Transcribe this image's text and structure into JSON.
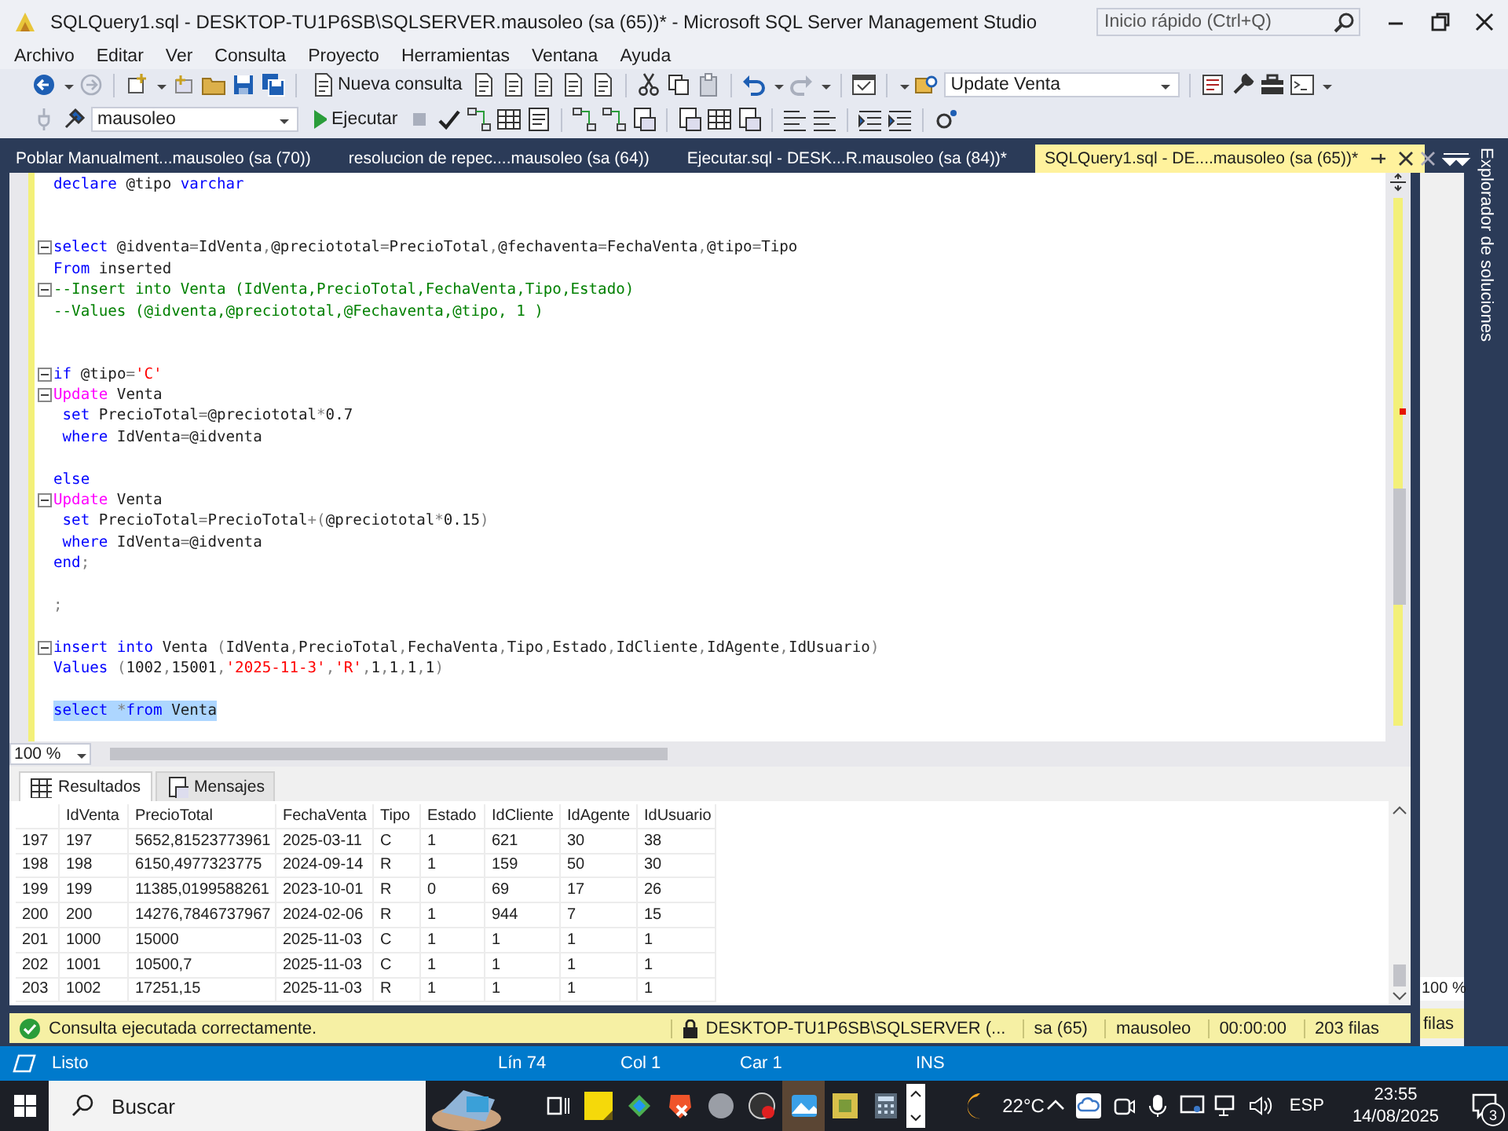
{
  "window": {
    "title": "SQLQuery1.sql - DESKTOP-TU1P6SB\\SQLSERVER.mausoleo (sa (65))* - Microsoft SQL Server Management Studio",
    "quick_launch": {
      "placeholder": "Inicio rápido (Ctrl+Q)"
    }
  },
  "menu": [
    "Archivo",
    "Editar",
    "Ver",
    "Consulta",
    "Proyecto",
    "Herramientas",
    "Ventana",
    "Ayuda"
  ],
  "toolbar": {
    "new_query": "Nueva consulta",
    "object_combo": "Update Venta",
    "database_combo": "mausoleo",
    "execute": "Ejecutar"
  },
  "doc_tabs": [
    {
      "label": "Poblar Manualment...mausoleo (sa (70))",
      "selected": false
    },
    {
      "label": "resolucion de repec....mausoleo (sa (64))",
      "selected": false
    },
    {
      "label": "Ejecutar.sql - DESK...R.mausoleo (sa (84))*",
      "selected": false
    },
    {
      "label": "SQLQuery1.sql - DE....mausoleo (sa (65))*",
      "selected": true
    }
  ],
  "editor": {
    "zoom": "100 %",
    "lines": [
      {
        "kind": "code",
        "selected": false,
        "tokens": [
          {
            "text": "declare",
            "kind": "keyword"
          },
          {
            "text": " @tipo ",
            "kind": "plain"
          },
          {
            "text": "varchar",
            "kind": "keyword"
          }
        ]
      },
      {
        "kind": "blank"
      },
      {
        "kind": "blank"
      },
      {
        "kind": "block",
        "selected": false,
        "tokens": [
          {
            "text": "select",
            "kind": "keyword"
          },
          {
            "text": " @idventa=IdVenta,@preciototal=PrecioTotal,@fechaventa=FechaVenta,@tipo=Tipo",
            "kind": "plain"
          }
        ]
      },
      {
        "kind": "code",
        "selected": false,
        "tokens": [
          {
            "text": "From",
            "kind": "keyword"
          },
          {
            "text": " inserted",
            "kind": "plain"
          }
        ]
      },
      {
        "kind": "block",
        "selected": false,
        "tokens": [
          {
            "text": "--Insert into Venta (IdVenta,PrecioTotal,FechaVenta,Tipo,Estado)",
            "kind": "comment"
          }
        ]
      },
      {
        "kind": "code",
        "selected": false,
        "tokens": [
          {
            "text": "--Values (@idventa,@preciototal,@Fechaventa,@tipo, 1 )",
            "kind": "comment"
          }
        ]
      },
      {
        "kind": "blank"
      },
      {
        "kind": "blank"
      },
      {
        "kind": "block",
        "selected": false,
        "tokens": [
          {
            "text": "if",
            "kind": "keyword"
          },
          {
            "text": " @tipo=",
            "kind": "plain"
          },
          {
            "text": "'C'",
            "kind": "string"
          }
        ]
      },
      {
        "kind": "block",
        "selected": false,
        "tokens": [
          {
            "text": "Update",
            "kind": "function"
          },
          {
            "text": " Venta",
            "kind": "plain"
          }
        ]
      },
      {
        "kind": "code",
        "selected": false,
        "tokens": [
          {
            "text": " set",
            "kind": "keyword"
          },
          {
            "text": " PrecioTotal=@preciototal*0.7",
            "kind": "plain"
          }
        ]
      },
      {
        "kind": "code",
        "selected": false,
        "tokens": [
          {
            "text": " where",
            "kind": "keyword"
          },
          {
            "text": " IdVenta=@idventa",
            "kind": "plain"
          }
        ]
      },
      {
        "kind": "blank"
      },
      {
        "kind": "code",
        "selected": false,
        "tokens": [
          {
            "text": "else",
            "kind": "keyword"
          }
        ]
      },
      {
        "kind": "block",
        "selected": false,
        "tokens": [
          {
            "text": "Update",
            "kind": "function"
          },
          {
            "text": " Venta",
            "kind": "plain"
          }
        ]
      },
      {
        "kind": "code",
        "selected": false,
        "tokens": [
          {
            "text": " set",
            "kind": "keyword"
          },
          {
            "text": " PrecioTotal=PrecioTotal+(@preciototal*0.15)",
            "kind": "plain"
          }
        ]
      },
      {
        "kind": "code",
        "selected": false,
        "tokens": [
          {
            "text": " where",
            "kind": "keyword"
          },
          {
            "text": " IdVenta=@idventa",
            "kind": "plain"
          }
        ]
      },
      {
        "kind": "code",
        "selected": false,
        "tokens": [
          {
            "text": "end",
            "kind": "keyword"
          },
          {
            "text": ";",
            "kind": "plain"
          }
        ]
      },
      {
        "kind": "blank"
      },
      {
        "kind": "code",
        "selected": false,
        "tokens": [
          {
            "text": ";",
            "kind": "plain"
          }
        ]
      },
      {
        "kind": "blank"
      },
      {
        "kind": "block",
        "selected": false,
        "tokens": [
          {
            "text": "insert into",
            "kind": "keyword"
          },
          {
            "text": " Venta (IdVenta,PrecioTotal,FechaVenta,Tipo,Estado,IdCliente,IdAgente,IdUsuario)",
            "kind": "plain"
          }
        ]
      },
      {
        "kind": "code",
        "selected": false,
        "tokens": [
          {
            "text": "Values",
            "kind": "keyword"
          },
          {
            "text": " (1002,15001,",
            "kind": "plain"
          },
          {
            "text": "'2025-11-3'",
            "kind": "string"
          },
          {
            "text": ",",
            "kind": "plain"
          },
          {
            "text": "'R'",
            "kind": "string"
          },
          {
            "text": ",1,1,1,1)",
            "kind": "plain"
          }
        ]
      },
      {
        "kind": "blank"
      },
      {
        "kind": "code",
        "selected": true,
        "tokens": [
          {
            "text": "select",
            "kind": "keyword"
          },
          {
            "text": " *",
            "kind": "plain"
          },
          {
            "text": "from",
            "kind": "keyword"
          },
          {
            "text": " Venta",
            "kind": "plain"
          }
        ]
      }
    ]
  },
  "results": {
    "tabs": [
      {
        "label": "Resultados",
        "selected": true
      },
      {
        "label": "Mensajes",
        "selected": false
      }
    ],
    "columns": [
      "IdVenta",
      "PrecioTotal",
      "FechaVenta",
      "Tipo",
      "Estado",
      "IdCliente",
      "IdAgente",
      "IdUsuario"
    ],
    "rows": [
      {
        "row": "197",
        "cells": [
          "197",
          "5652,81523773961",
          "2025-03-11",
          "C",
          "1",
          "621",
          "30",
          "38"
        ]
      },
      {
        "row": "198",
        "cells": [
          "198",
          "6150,4977323775",
          "2024-09-14",
          "R",
          "1",
          "159",
          "50",
          "30"
        ]
      },
      {
        "row": "199",
        "cells": [
          "199",
          "11385,0199588261",
          "2023-10-01",
          "R",
          "0",
          "69",
          "17",
          "26"
        ]
      },
      {
        "row": "200",
        "cells": [
          "200",
          "14276,7846737967",
          "2024-02-06",
          "R",
          "1",
          "944",
          "7",
          "15"
        ]
      },
      {
        "row": "201",
        "cells": [
          "1000",
          "15000",
          "2025-11-03",
          "C",
          "1",
          "1",
          "1",
          "1"
        ]
      },
      {
        "row": "202",
        "cells": [
          "1001",
          "10500,7",
          "2025-11-03",
          "C",
          "1",
          "1",
          "1",
          "1"
        ]
      },
      {
        "row": "203",
        "cells": [
          "1002",
          "17251,15",
          "2025-11-03",
          "R",
          "1",
          "1",
          "1",
          "1"
        ]
      }
    ]
  },
  "query_status": {
    "message": "Consulta ejecutada correctamente.",
    "server": "DESKTOP-TU1P6SB\\SQLSERVER (...",
    "user": "sa (65)",
    "database": "mausoleo",
    "elapsed": "00:00:00",
    "rows": "203 filas"
  },
  "side_panel": {
    "title": "Explorador de soluciones",
    "zoom": "100 %",
    "rows": "filas"
  },
  "status_bar": {
    "state": "Listo",
    "line": "Lín 74",
    "column": "Col 1",
    "char": "Car 1",
    "mode": "INS"
  },
  "taskbar": {
    "search": {
      "placeholder": "Buscar"
    },
    "temperature": "22°C",
    "language": "ESP",
    "time": "23:55",
    "date": "14/08/2025",
    "notifications": "3"
  }
}
